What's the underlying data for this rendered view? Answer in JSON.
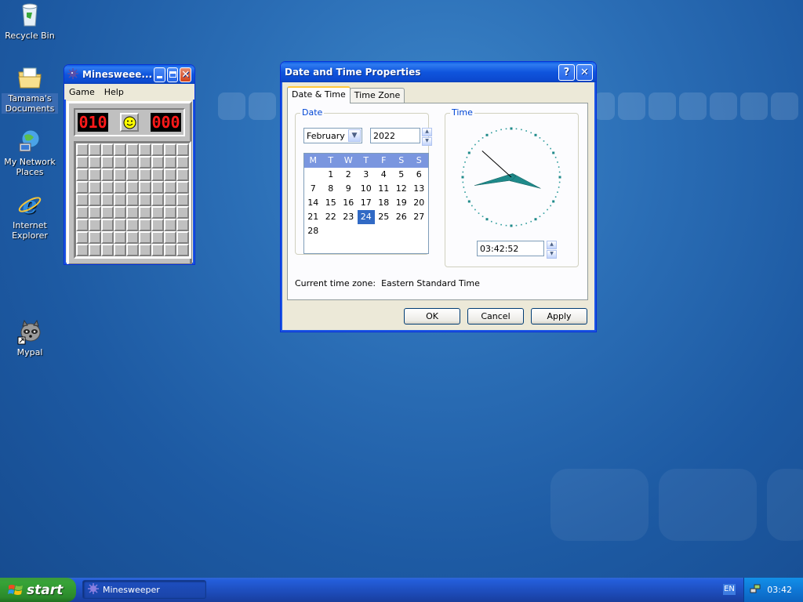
{
  "desktop": {
    "icons": [
      {
        "label": "Recycle Bin"
      },
      {
        "label": "Tamama's Documents"
      },
      {
        "label": "My Network Places"
      },
      {
        "label": "Internet Explorer"
      },
      {
        "label": "Mypal"
      }
    ]
  },
  "minesweeper": {
    "title": "Minesweeper",
    "title_display": "Minesweee...",
    "menu": {
      "game": "Game",
      "help": "Help"
    },
    "mines_left": "010",
    "timer": "000",
    "grid_rows": 9,
    "grid_cols": 9
  },
  "datetime": {
    "title": "Date and Time Properties",
    "help_glyph": "?",
    "close_glyph": "✕",
    "tabs": {
      "date_time": "Date & Time",
      "time_zone": "Time Zone"
    },
    "date_group": "Date",
    "time_group": "Time",
    "month": "February",
    "year": "2022",
    "weekdays": [
      "M",
      "T",
      "W",
      "T",
      "F",
      "S",
      "S"
    ],
    "first_weekday_offset": 1,
    "days_in_month": 28,
    "selected_day": 24,
    "time_value": "03:42:52",
    "clock": {
      "hours": 3,
      "minutes": 42,
      "seconds": 52
    },
    "timezone_label": "Current time zone:",
    "timezone_value": "Eastern Standard Time",
    "buttons": {
      "ok": "OK",
      "cancel": "Cancel",
      "apply": "Apply"
    }
  },
  "taskbar": {
    "start": "start",
    "items": [
      {
        "label": "Minesweeper"
      }
    ],
    "language": "EN",
    "clock": "03:42"
  },
  "colors": {
    "desktop_blue": "#2a6db5",
    "title_blue": "#0a5ee6",
    "start_green": "#37a337",
    "clock_hands": "#1f8a8a"
  }
}
